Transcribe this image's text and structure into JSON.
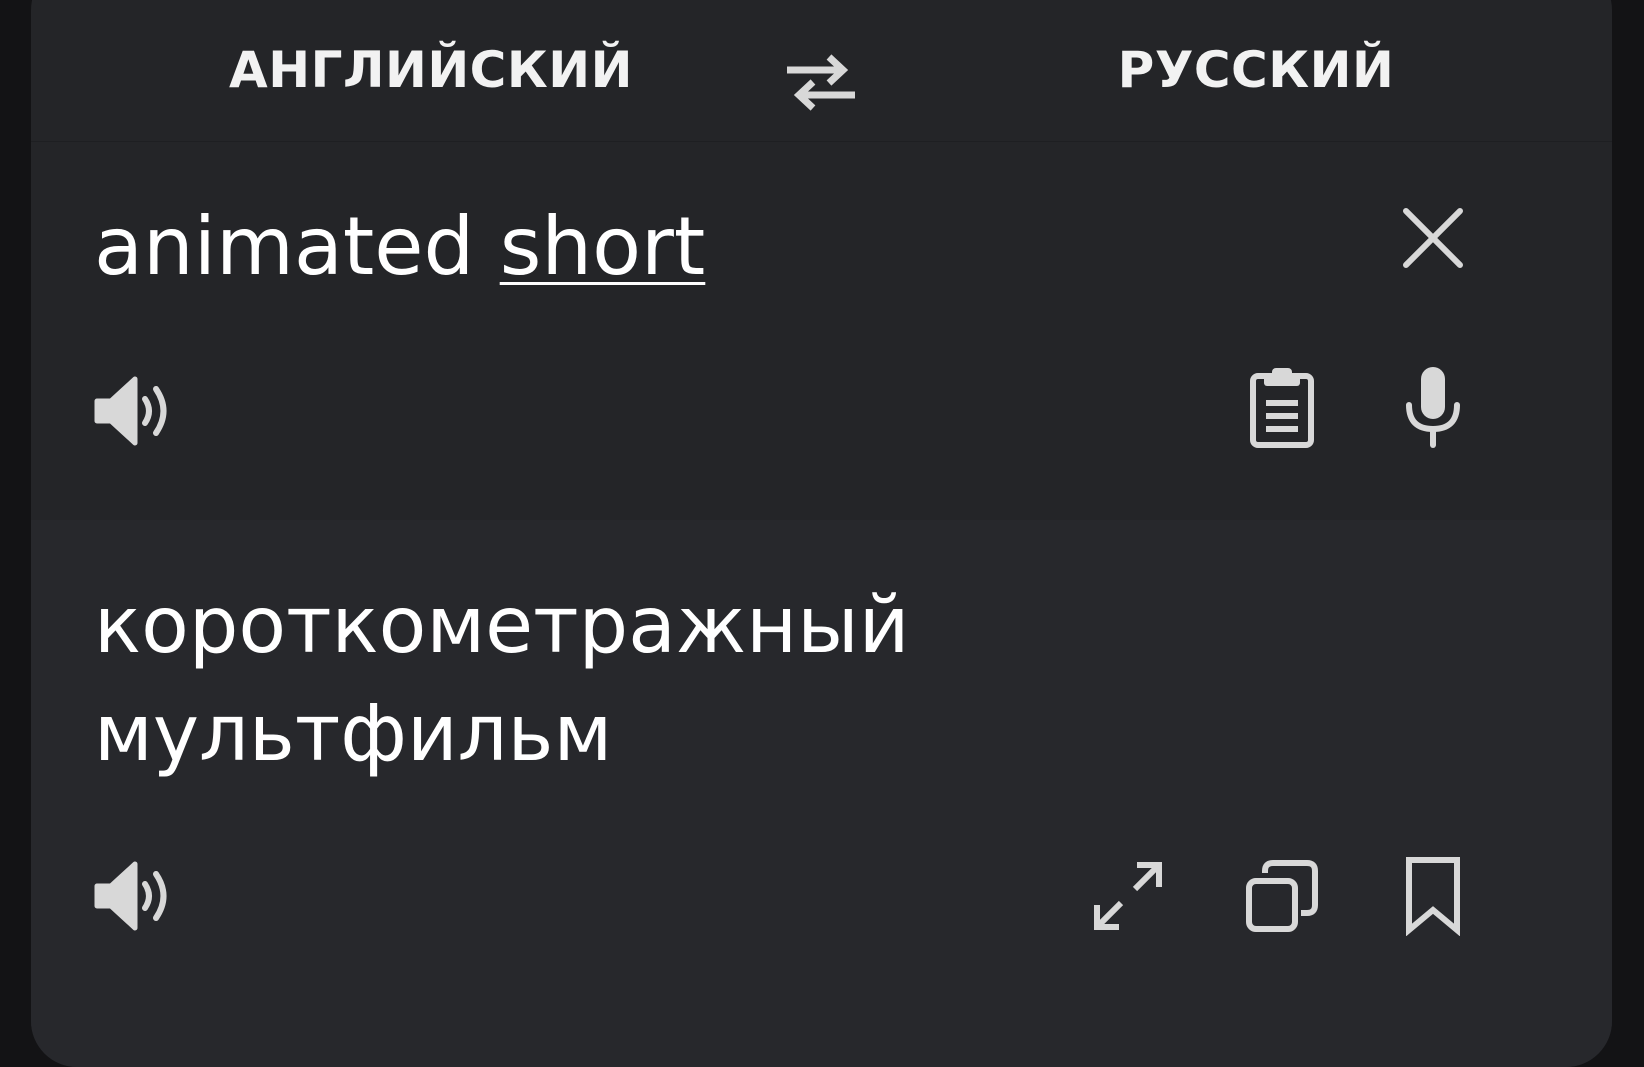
{
  "languages": {
    "source": "АНГЛИЙСКИЙ",
    "target": "РУССКИЙ",
    "swap_icon": "swap-arrows-icon"
  },
  "input": {
    "text_plain": "animated ",
    "text_underlined": "short",
    "icons": [
      "close-icon",
      "speaker-icon",
      "clipboard-icon",
      "microphone-icon"
    ]
  },
  "output": {
    "line1": "короткометражный",
    "line2": "мультфильм",
    "icons": [
      "speaker-icon",
      "expand-icon",
      "copy-icon",
      "bookmark-icon"
    ]
  },
  "colors": {
    "background": "#131315",
    "card": "#242528",
    "output_panel": "#27282c",
    "text": "#ffffff",
    "icon": "#d8d8d8"
  }
}
